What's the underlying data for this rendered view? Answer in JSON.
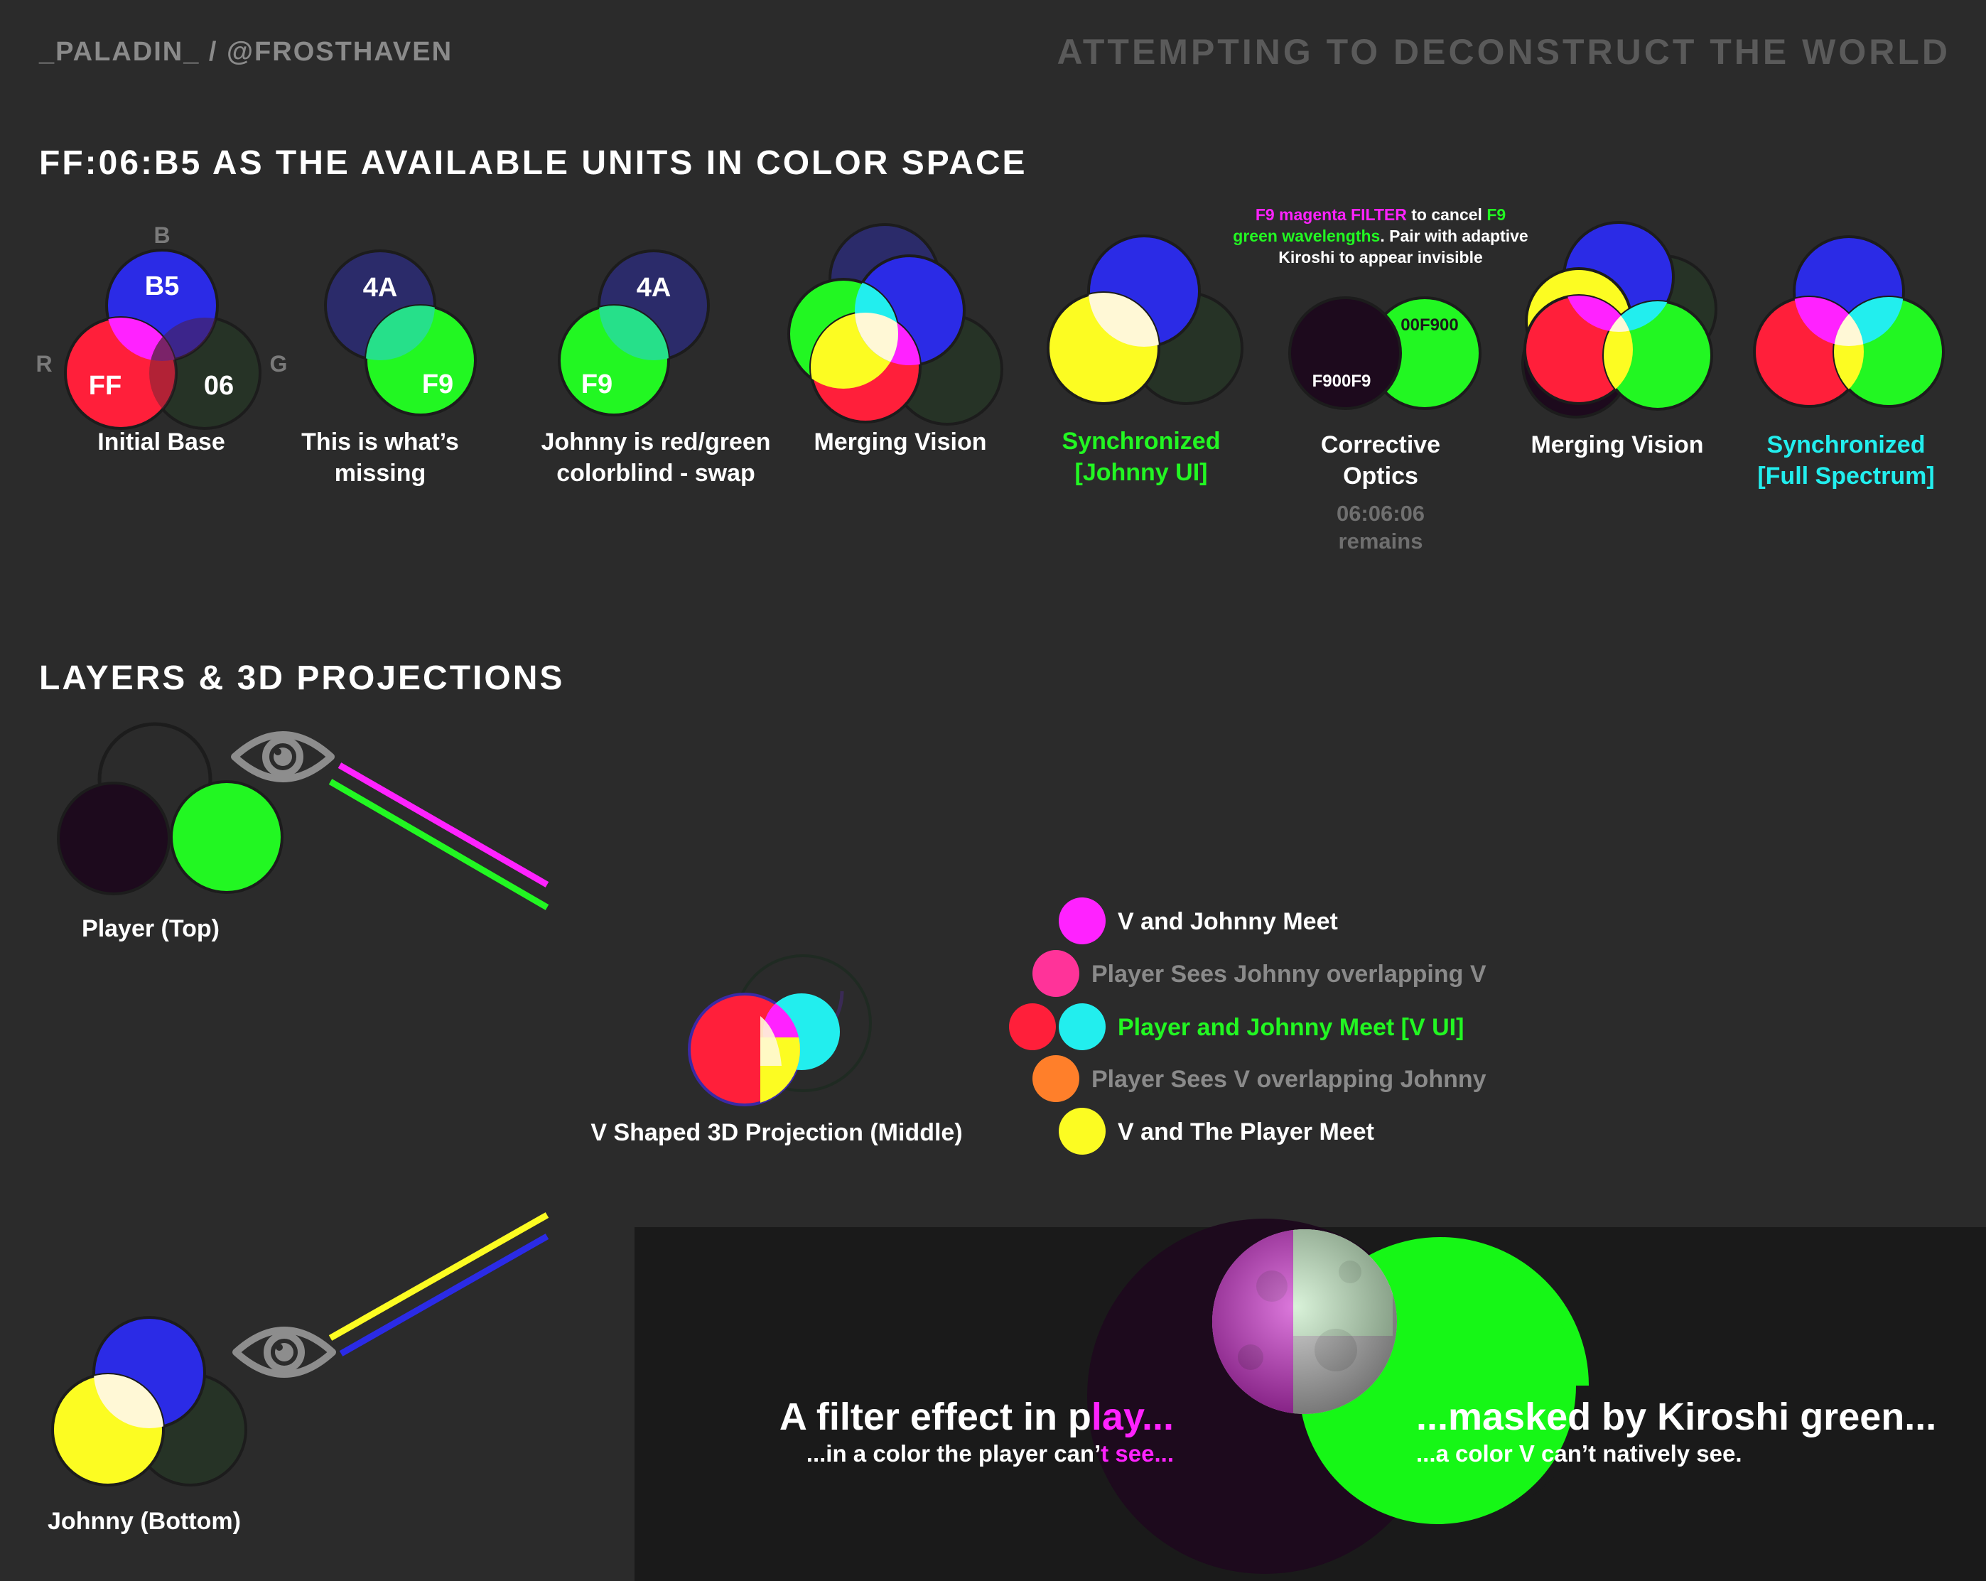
{
  "header": {
    "handle": "_PALADIN_ / @FROSTHAVEN",
    "tagline": "ATTEMPTING TO DECONSTRUCT THE WORLD"
  },
  "section1": {
    "title": "FF:06:B5 AS THE AVAILABLE UNITS IN COLOR SPACE",
    "axes": {
      "b": "B",
      "r": "R",
      "g": "G"
    },
    "panels": [
      {
        "caption": [
          "Initial Base"
        ],
        "labels": [
          "B5",
          "FF",
          "06"
        ]
      },
      {
        "caption": [
          "This is what’s",
          "missing"
        ],
        "labels": [
          "4A",
          "F9"
        ]
      },
      {
        "caption": [
          "Johnny is red/green",
          "colorblind - swap"
        ],
        "labels": [
          "4A",
          "F9"
        ]
      },
      {
        "caption": [
          "Merging Vision"
        ]
      },
      {
        "caption": [
          "Synchronized",
          "[Johnny UI]"
        ]
      },
      {
        "caption": [
          "Corrective",
          "Optics"
        ],
        "labels": [
          "00F900",
          "F900F9"
        ],
        "sub": [
          "06:06:06",
          "remains"
        ]
      },
      {
        "caption": [
          "Merging Vision"
        ]
      },
      {
        "caption": [
          "Synchronized",
          "[Full Spectrum]"
        ]
      }
    ],
    "filter_note": {
      "line1": [
        "F9 magenta FILTER",
        " to cancel ",
        "F9"
      ],
      "line2": [
        "green wavelengths",
        ". Pair with adaptive"
      ],
      "line3": "Kiroshi to appear invisible"
    }
  },
  "section2": {
    "title": "LAYERS & 3D PROJECTIONS",
    "player_label": "Player (Top)",
    "johnny_label": "Johnny (Bottom)",
    "projection_label": "V Shaped 3D Projection (Middle)",
    "legend": [
      "V and Johnny Meet",
      "Player Sees Johnny overlapping V",
      "Player and Johnny Meet [V UI]",
      "Player Sees V overlapping Johnny",
      "V and The Player Meet"
    ]
  },
  "moon_panel": {
    "left_title": [
      "A filter effect in p",
      "lay..."
    ],
    "left_sub": [
      "...in a color the player can’",
      "t see..."
    ],
    "right_title": [
      "...mask",
      "ed by Kiroshi green..."
    ],
    "right_sub": "...a color V can’t natively see."
  },
  "colors": {
    "background": "#2b2b2b",
    "red": "#ff1f3a",
    "green": "#22f722",
    "blue": "#2b2be6",
    "yellow": "#fcfc22",
    "magenta": "#ff22ff",
    "cyan": "#22eeee",
    "dark_purple": "#1d0a1d",
    "moon_bg": "#1a1a1a"
  },
  "icons": [
    "eye-icon",
    "moon-icon"
  ]
}
